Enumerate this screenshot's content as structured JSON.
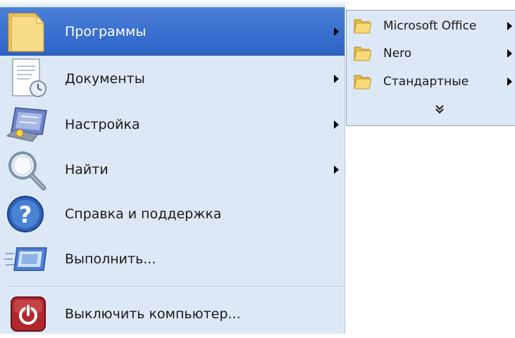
{
  "start_menu": {
    "items": [
      {
        "label": "Программы",
        "has_submenu": true,
        "selected": true,
        "icon": "folder-icon"
      },
      {
        "label": "Документы",
        "has_submenu": true,
        "selected": false,
        "icon": "documents-icon"
      },
      {
        "label": "Настройка",
        "has_submenu": true,
        "selected": false,
        "icon": "control-panel-icon"
      },
      {
        "label": "Найти",
        "has_submenu": true,
        "selected": false,
        "icon": "search-icon"
      },
      {
        "label": "Справка и поддержка",
        "has_submenu": false,
        "selected": false,
        "icon": "help-icon"
      },
      {
        "label": "Выполнить...",
        "has_submenu": false,
        "selected": false,
        "icon": "run-icon"
      },
      {
        "label": "Выключить компьютер...",
        "has_submenu": false,
        "selected": false,
        "icon": "power-icon"
      }
    ]
  },
  "programs_submenu": {
    "items": [
      {
        "label": "Microsoft Office",
        "has_submenu": true,
        "icon": "folder-icon"
      },
      {
        "label": "Nero",
        "has_submenu": true,
        "icon": "folder-icon"
      },
      {
        "label": "Стандартные",
        "has_submenu": true,
        "icon": "folder-icon"
      }
    ],
    "expand_icon": "double-chevron-down-icon"
  },
  "colors": {
    "menu_background": "#dce8f6",
    "selection_blue": "#3b72d0",
    "selected_text": "#ffffff",
    "text": "#1a1a1a",
    "folder_yellow": "#f7d772"
  }
}
